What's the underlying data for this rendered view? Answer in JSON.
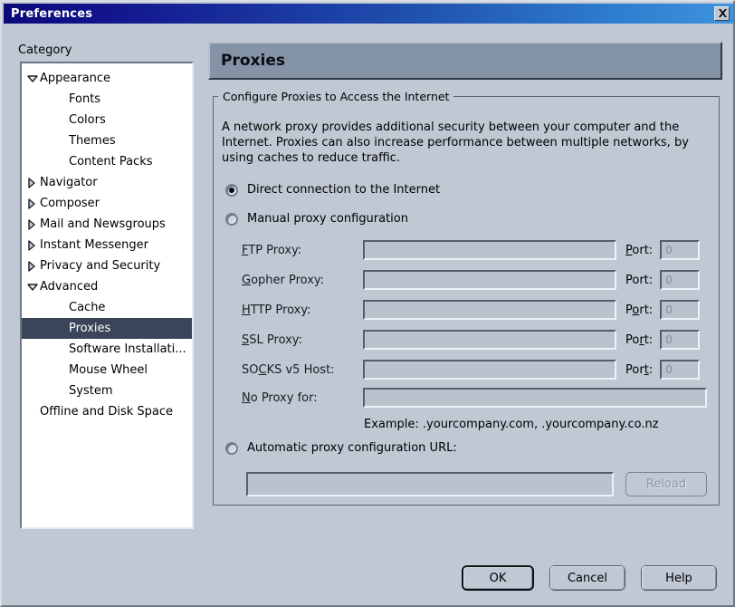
{
  "window": {
    "title": "Preferences",
    "close_icon": "close-x-icon"
  },
  "sidebar": {
    "label": "Category",
    "items": [
      {
        "label": "Appearance",
        "indent": 0,
        "twisty": "down",
        "selected": false
      },
      {
        "label": "Fonts",
        "indent": 1,
        "twisty": "none",
        "selected": false
      },
      {
        "label": "Colors",
        "indent": 1,
        "twisty": "none",
        "selected": false
      },
      {
        "label": "Themes",
        "indent": 1,
        "twisty": "none",
        "selected": false
      },
      {
        "label": "Content Packs",
        "indent": 1,
        "twisty": "none",
        "selected": false
      },
      {
        "label": "Navigator",
        "indent": 0,
        "twisty": "right",
        "selected": false
      },
      {
        "label": "Composer",
        "indent": 0,
        "twisty": "right",
        "selected": false
      },
      {
        "label": "Mail and Newsgroups",
        "indent": 0,
        "twisty": "right",
        "selected": false
      },
      {
        "label": "Instant Messenger",
        "indent": 0,
        "twisty": "right",
        "selected": false
      },
      {
        "label": "Privacy and Security",
        "indent": 0,
        "twisty": "right",
        "selected": false
      },
      {
        "label": "Advanced",
        "indent": 0,
        "twisty": "down",
        "selected": false
      },
      {
        "label": "Cache",
        "indent": 1,
        "twisty": "none",
        "selected": false
      },
      {
        "label": "Proxies",
        "indent": 1,
        "twisty": "none",
        "selected": true
      },
      {
        "label": "Software Installati...",
        "indent": 1,
        "twisty": "none",
        "selected": false
      },
      {
        "label": "Mouse Wheel",
        "indent": 1,
        "twisty": "none",
        "selected": false
      },
      {
        "label": "System",
        "indent": 1,
        "twisty": "none",
        "selected": false
      },
      {
        "label": "Offline and Disk Space",
        "indent": 0,
        "twisty": "none",
        "selected": false
      }
    ]
  },
  "panel": {
    "title": "Proxies",
    "legend": "Configure Proxies to Access the Internet",
    "description": "A network proxy provides additional security between your computer and the Internet. Proxies can also increase performance between multiple networks, by using caches to reduce traffic.",
    "radios": [
      {
        "label": "Direct connection to the Internet",
        "checked": true
      },
      {
        "label": "Manual proxy configuration",
        "checked": false
      },
      {
        "label": "Automatic proxy configuration URL:",
        "checked": false
      }
    ],
    "proxy_rows": [
      {
        "label_pre": "",
        "label_key": "F",
        "label_post": "TP Proxy:",
        "value": "",
        "port_label_pre": "",
        "port_label_key": "P",
        "port_label_post": "ort:",
        "port_value": "0"
      },
      {
        "label_pre": "",
        "label_key": "G",
        "label_post": "opher Proxy:",
        "value": "",
        "port_label_pre": "Port:",
        "port_label_key": "",
        "port_label_post": "",
        "port_value": "0"
      },
      {
        "label_pre": "",
        "label_key": "H",
        "label_post": "TTP Proxy:",
        "value": "",
        "port_label_pre": "P",
        "port_label_key": "o",
        "port_label_post": "rt:",
        "port_value": "0"
      },
      {
        "label_pre": "",
        "label_key": "S",
        "label_post": "SL Proxy:",
        "value": "",
        "port_label_pre": "Po",
        "port_label_key": "r",
        "port_label_post": "t:",
        "port_value": "0"
      },
      {
        "label_pre": "SO",
        "label_key": "C",
        "label_post": "KS v5 Host:",
        "value": "",
        "port_label_pre": "Por",
        "port_label_key": "t",
        "port_label_post": ":",
        "port_value": "0"
      }
    ],
    "no_proxy": {
      "label_pre": "",
      "label_key": "N",
      "label_post": "o Proxy for:",
      "value": "",
      "example": "Example: .yourcompany.com, .yourcompany.co.nz"
    },
    "auto_url": {
      "value": "",
      "reload_label": "Reload"
    }
  },
  "buttons": {
    "ok": "OK",
    "cancel": "Cancel",
    "help": "Help"
  }
}
